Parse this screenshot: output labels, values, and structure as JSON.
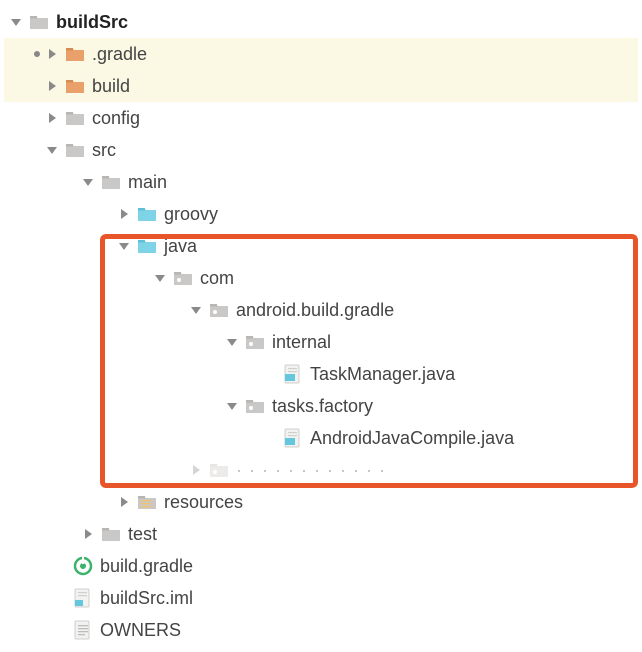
{
  "tree": {
    "root": "buildSrc",
    "gradle_dir": ".gradle",
    "build_dir": "build",
    "config_dir": "config",
    "src_dir": "src",
    "main_dir": "main",
    "groovy_dir": "groovy",
    "java_dir": "java",
    "com_dir": "com",
    "android_pkg": "android.build.gradle",
    "internal_dir": "internal",
    "taskmanager_file": "TaskManager.java",
    "tasksfactory_dir": "tasks.factory",
    "androidjavacompile_file": "AndroidJavaCompile.java",
    "resources_dir": "resources",
    "test_dir": "test",
    "buildgradle_file": "build.gradle",
    "buildsrciml_file": "buildSrc.iml",
    "owners_file": "OWNERS"
  },
  "colors": {
    "highlight_border": "#e9552b",
    "row_highlight": "#fbf8e4"
  }
}
